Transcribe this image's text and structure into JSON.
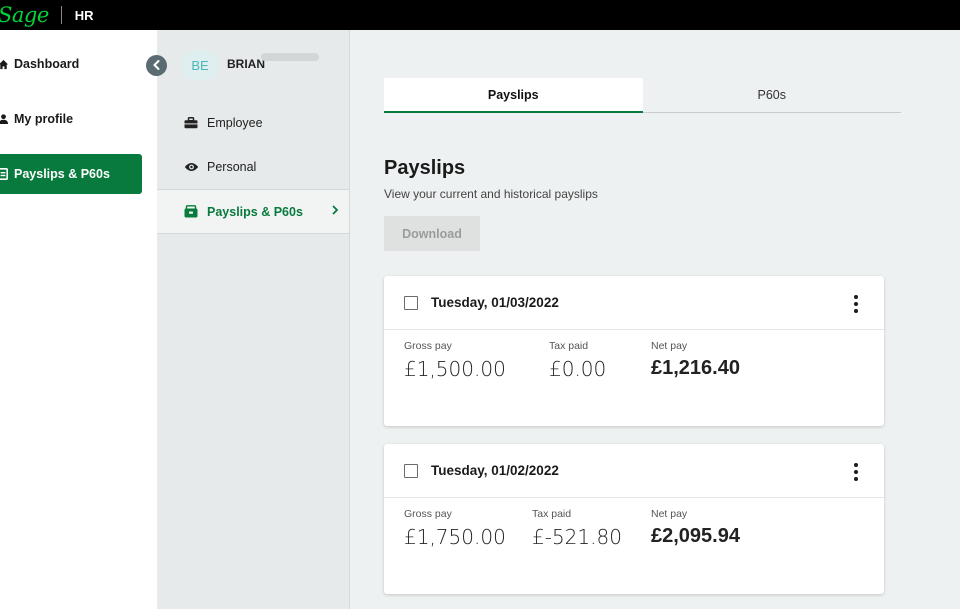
{
  "topbar": {
    "logo": "Sage",
    "app_name": "HR"
  },
  "leftnav": {
    "items": [
      {
        "label": "Dashboard",
        "icon": "home-icon"
      },
      {
        "label": "My profile",
        "icon": "person-icon"
      },
      {
        "label": "Payslips & P60s",
        "icon": "document-icon",
        "active": true
      }
    ]
  },
  "subpanel": {
    "avatar_initials": "BE",
    "user_name": "BRIAN",
    "items": [
      {
        "label": "Employee",
        "icon": "briefcase-icon"
      },
      {
        "label": "Personal",
        "icon": "eye-icon"
      },
      {
        "label": "Payslips & P60s",
        "icon": "wallet-icon",
        "active": true
      }
    ]
  },
  "tabs": [
    {
      "label": "Payslips",
      "active": true
    },
    {
      "label": "P60s",
      "active": false
    }
  ],
  "main": {
    "title": "Payslips",
    "subtitle": "View your current and historical payslips",
    "download_label": "Download"
  },
  "payslips": [
    {
      "date": "Tuesday, 01/03/2022",
      "gross_label": "Gross pay",
      "gross": "£1,500.00",
      "tax_label": "Tax paid",
      "tax": "£0.00",
      "net_label": "Net pay",
      "net": "£1,216.40"
    },
    {
      "date": "Tuesday, 01/02/2022",
      "gross_label": "Gross pay",
      "gross": "£1,750.00",
      "tax_label": "Tax paid",
      "tax": "£-521.80",
      "net_label": "Net pay",
      "net": "£2,095.94"
    }
  ],
  "colors": {
    "brand_green": "#087a3d",
    "logo_green": "#00d639",
    "topbar": "#000000"
  }
}
